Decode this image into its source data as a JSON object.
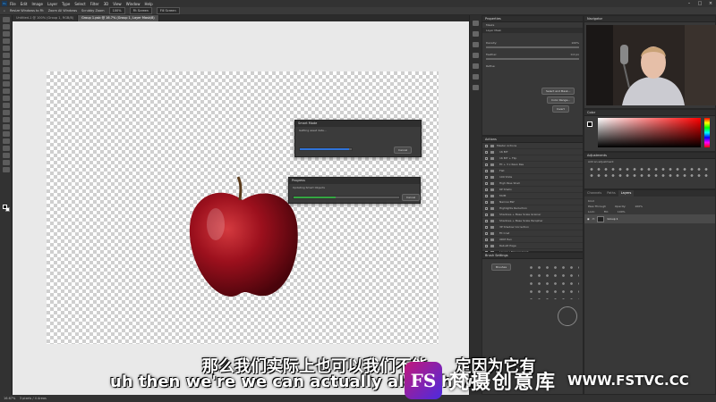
{
  "menubar": {
    "logo": "Ps",
    "items": [
      "File",
      "Edit",
      "Image",
      "Layer",
      "Type",
      "Select",
      "Filter",
      "3D",
      "View",
      "Window",
      "Help"
    ]
  },
  "options_bar": {
    "items": [
      "Resize Windows to Fit",
      "Zoom All Windows",
      "Scrubby Zoom",
      "100%",
      "Fit Screen",
      "Fill Screen"
    ]
  },
  "tabs": [
    {
      "label": "Untitled-1 @ 100% (Group 1, RGB/8)",
      "active": false
    },
    {
      "label": "Group 1.psb @ 16.7% (Group 1, Layer Mask/8)",
      "active": true
    }
  ],
  "dialogs": {
    "smart_mode": {
      "title": "Smart Mode",
      "text": "Getting asset data...",
      "cancel": "Cancel",
      "progress": 0.95
    },
    "progress": {
      "title": "Progress",
      "text": "Updating Smart Objects",
      "cancel": "Cancel",
      "progress": 0.4
    }
  },
  "properties": {
    "header": "Properties",
    "subheader": "Masks",
    "mask_label": "Layer Mask",
    "density_label": "Density:",
    "density_value": "100%",
    "feather_label": "Feather:",
    "feather_value": "0.0 px",
    "refine_label": "Refine:",
    "buttons": [
      "Select and Mask...",
      "Color Range...",
      "Invert"
    ]
  },
  "navigator": {
    "header": "Navigator"
  },
  "color_panel": {
    "header": "Color"
  },
  "adjustments": {
    "header": "Adjustments",
    "sub": "Add an adjustment"
  },
  "actions": {
    "header": "Actions",
    "items": [
      "Master Actions",
      "16 BIT",
      "16 BIT + Flip",
      "Fit + 3 x Resn Res",
      "Flat",
      "100 Shde",
      "High Pass Shall",
      "6P Shallo",
      "MUM",
      "Narrow BW",
      "Highlights Reduction",
      "Shadows + Base Scale Grainer",
      "Shadows + Base Scale Peropher",
      "3P Shadow Correction",
      "Fit Cnst",
      "XDM Hen",
      "Rebuilt Page",
      "Layers / Management"
    ]
  },
  "layers": {
    "tabs": [
      "Channels",
      "Paths",
      "Layers"
    ],
    "kind_label": "Kind",
    "blend_mode": "Pass Through",
    "opacity_label": "Opacity:",
    "opacity_value": "100%",
    "lock_label": "Lock:",
    "fill_label": "Fill:",
    "fill_value": "100%",
    "row_label": "Group 1"
  },
  "brush_settings": {
    "header": "Brush Settings",
    "button": "Brushes"
  },
  "status_bar": {
    "zoom": "16.67%",
    "info": "3 pixels / 4 Areas"
  },
  "subtitles": {
    "chinese": "那么我们实际上也可以我们不能",
    "chinese_tail": "定因为它有",
    "english": "uh then we're we can actually also ah we"
  },
  "watermark": {
    "logo_text": "FS",
    "name": "梵摄创意库",
    "url": "WWW.FSTVC.CC"
  },
  "colors": {
    "progress_blue": "#2f73d9",
    "progress_green": "#35a642",
    "apple_red": "#8e0f1a"
  }
}
